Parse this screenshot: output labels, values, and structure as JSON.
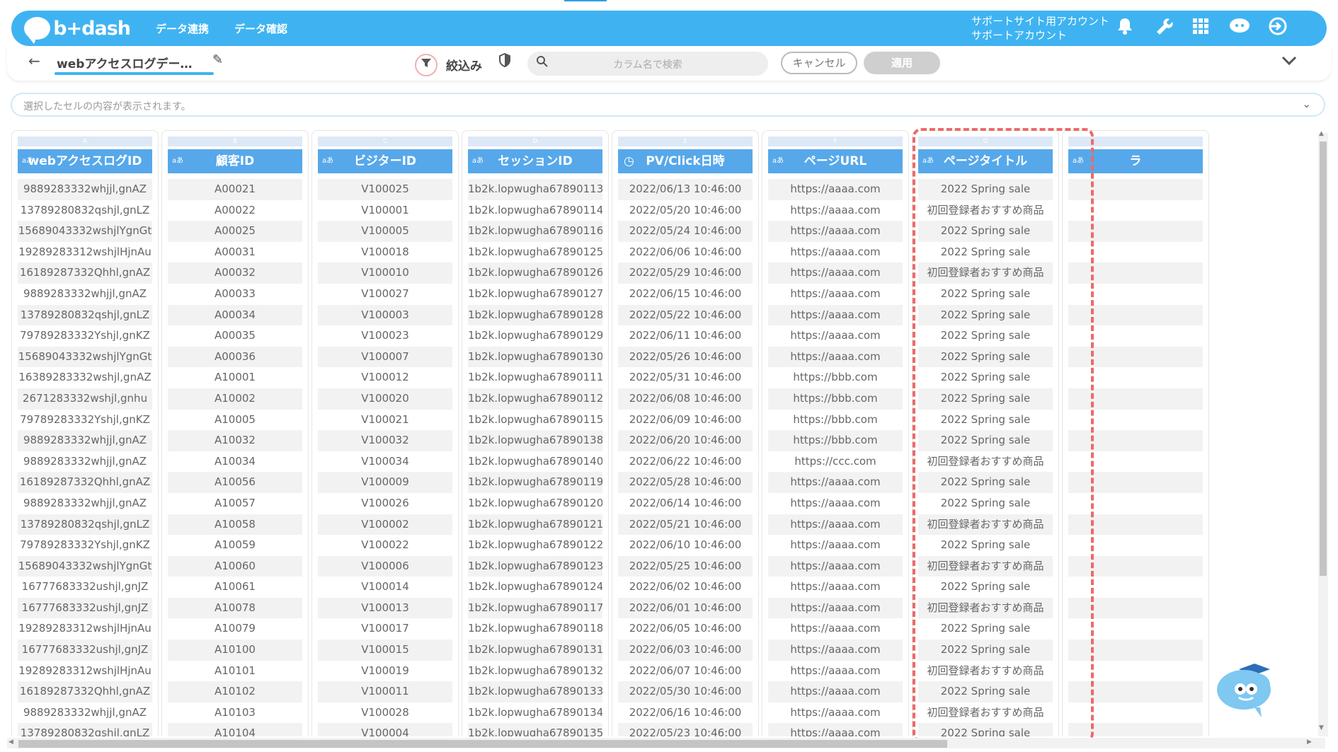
{
  "header": {
    "logo": "b+dash",
    "menu": [
      "データ連携",
      "データ確認"
    ],
    "account_line1": "サポートサイト用アカウント",
    "account_line2": "サポートアカウント"
  },
  "toolbar": {
    "table_name": "webアクセスログデー…",
    "filter_label": "絞込み",
    "search_placeholder": "カラム名で検索",
    "cancel_label": "キャンセル",
    "apply_label": "適用"
  },
  "cell_preview": {
    "placeholder": "選択したセルの内容が表示されます。"
  },
  "columns": [
    {
      "letter": "A",
      "type": "text",
      "type_label": "aあ",
      "name": "webアクセスログID",
      "cells": [
        "9889283332whjjl,gnAZ",
        "13789280832qshjl,gnLZ",
        "15689043332wshjlYgnGt",
        "19289283312wshjlHjnAu",
        "16189287332Qhhl,gnAZ",
        "9889283332whjjl,gnAZ",
        "13789280832qshjl,gnLZ",
        "79789283332Yshjl,gnKZ",
        "15689043332wshjlYgnGt",
        "16389283332wshjl,gnAZ",
        "2671283332wshjl,gnhu",
        "79789283332Yshjl,gnKZ",
        "9889283332whjjl,gnAZ",
        "9889283332whjjl,gnAZ",
        "16189287332Qhhl,gnAZ",
        "9889283332whjjl,gnAZ",
        "13789280832qshjl,gnLZ",
        "79789283332Yshjl,gnKZ",
        "15689043332wshjlYgnGt",
        "16777683332ushjl,gnJZ",
        "16777683332ushjl,gnJZ",
        "19289283312wshjlHjnAu",
        "16777683332ushjl,gnJZ",
        "19289283312wshjlHjnAu",
        "16189287332Qhhl,gnAZ",
        "9889283332whjjl,gnAZ",
        "13789280832qshjl,gnLZ"
      ]
    },
    {
      "letter": "B",
      "type": "text",
      "type_label": "aあ",
      "name": "顧客ID",
      "cells": [
        "A00021",
        "A00022",
        "A00025",
        "A00031",
        "A00032",
        "A00033",
        "A00034",
        "A00035",
        "A00036",
        "A10001",
        "A10002",
        "A10005",
        "A10032",
        "A10034",
        "A10056",
        "A10057",
        "A10058",
        "A10059",
        "A10060",
        "A10061",
        "A10078",
        "A10079",
        "A10100",
        "A10101",
        "A10102",
        "A10103",
        "A10104"
      ]
    },
    {
      "letter": "C",
      "type": "text",
      "type_label": "aあ",
      "name": "ビジターID",
      "cells": [
        "V100025",
        "V100001",
        "V100005",
        "V100018",
        "V100010",
        "V100027",
        "V100003",
        "V100023",
        "V100007",
        "V100012",
        "V100020",
        "V100021",
        "V100032",
        "V100034",
        "V100009",
        "V100026",
        "V100002",
        "V100022",
        "V100006",
        "V100014",
        "V100013",
        "V100017",
        "V100015",
        "V100019",
        "V100011",
        "V100028",
        "V100004"
      ]
    },
    {
      "letter": "D",
      "type": "text",
      "type_label": "aあ",
      "name": "セッションID",
      "cells": [
        "1b2k.lopwugha67890113",
        "1b2k.lopwugha67890114",
        "1b2k.lopwugha67890116",
        "1b2k.lopwugha67890125",
        "1b2k.lopwugha67890126",
        "1b2k.lopwugha67890127",
        "1b2k.lopwugha67890128",
        "1b2k.lopwugha67890129",
        "1b2k.lopwugha67890130",
        "1b2k.lopwugha67890111",
        "1b2k.lopwugha67890112",
        "1b2k.lopwugha67890115",
        "1b2k.lopwugha67890138",
        "1b2k.lopwugha67890140",
        "1b2k.lopwugha67890119",
        "1b2k.lopwugha67890120",
        "1b2k.lopwugha67890121",
        "1b2k.lopwugha67890122",
        "1b2k.lopwugha67890123",
        "1b2k.lopwugha67890124",
        "1b2k.lopwugha67890117",
        "1b2k.lopwugha67890118",
        "1b2k.lopwugha67890131",
        "1b2k.lopwugha67890132",
        "1b2k.lopwugha67890133",
        "1b2k.lopwugha67890134",
        "1b2k.lopwugha67890135"
      ]
    },
    {
      "letter": "E",
      "type": "datetime",
      "type_label": "◷",
      "name": "PV/Click日時",
      "cells": [
        "2022/06/13 10:46:00",
        "2022/05/20 10:46:00",
        "2022/05/24 10:46:00",
        "2022/06/06 10:46:00",
        "2022/05/29 10:46:00",
        "2022/06/15 10:46:00",
        "2022/05/22 10:46:00",
        "2022/06/11 10:46:00",
        "2022/05/26 10:46:00",
        "2022/05/31 10:46:00",
        "2022/06/08 10:46:00",
        "2022/06/09 10:46:00",
        "2022/06/20 10:46:00",
        "2022/06/22 10:46:00",
        "2022/05/28 10:46:00",
        "2022/06/14 10:46:00",
        "2022/05/21 10:46:00",
        "2022/06/10 10:46:00",
        "2022/05/25 10:46:00",
        "2022/06/02 10:46:00",
        "2022/06/01 10:46:00",
        "2022/06/05 10:46:00",
        "2022/06/03 10:46:00",
        "2022/06/07 10:46:00",
        "2022/05/30 10:46:00",
        "2022/06/16 10:46:00",
        "2022/05/23 10:46:00"
      ]
    },
    {
      "letter": "F",
      "type": "text",
      "type_label": "aあ",
      "name": "ページURL",
      "cells": [
        "https://aaaa.com",
        "https://aaaa.com",
        "https://aaaa.com",
        "https://aaaa.com",
        "https://aaaa.com",
        "https://aaaa.com",
        "https://aaaa.com",
        "https://aaaa.com",
        "https://aaaa.com",
        "https://bbb.com",
        "https://bbb.com",
        "https://bbb.com",
        "https://bbb.com",
        "https://ccc.com",
        "https://aaaa.com",
        "https://aaaa.com",
        "https://aaaa.com",
        "https://aaaa.com",
        "https://aaaa.com",
        "https://aaaa.com",
        "https://aaaa.com",
        "https://aaaa.com",
        "https://aaaa.com",
        "https://aaaa.com",
        "https://aaaa.com",
        "https://aaaa.com",
        "https://aaaa.com"
      ]
    },
    {
      "letter": "G",
      "type": "text",
      "type_label": "aあ",
      "name": "ページタイトル",
      "cells": [
        "2022 Spring sale",
        "初回登録者おすすめ商品",
        "2022 Spring sale",
        "2022 Spring sale",
        "初回登録者おすすめ商品",
        "2022 Spring sale",
        "2022 Spring sale",
        "2022 Spring sale",
        "2022 Spring sale",
        "2022 Spring sale",
        "2022 Spring sale",
        "2022 Spring sale",
        "2022 Spring sale",
        "初回登録者おすすめ商品",
        "2022 Spring sale",
        "2022 Spring sale",
        "初回登録者おすすめ商品",
        "2022 Spring sale",
        "初回登録者おすすめ商品",
        "2022 Spring sale",
        "初回登録者おすすめ商品",
        "2022 Spring sale",
        "2022 Spring sale",
        "初回登録者おすすめ商品",
        "2022 Spring sale",
        "初回登録者おすすめ商品",
        "2022 Spring sale"
      ]
    },
    {
      "letter": "",
      "type": "text",
      "type_label": "aあ",
      "name": "ラ",
      "cells": [
        "",
        "",
        "",
        "",
        "",
        "",
        "",
        "",
        "",
        "",
        "",
        "",
        "",
        "",
        "",
        "",
        "",
        "",
        "",
        "",
        "",
        "",
        "",
        "",
        "",
        "",
        ""
      ]
    }
  ],
  "colors": {
    "header_bg": "#3fb3f2",
    "column_header_bg": "#56a8ea",
    "highlight_border": "#ec6a6a"
  },
  "icons": [
    "bell-icon",
    "wrench-icon",
    "apps-grid-icon",
    "chat-cloud-icon",
    "logout-icon",
    "back-arrow-icon",
    "pencil-icon",
    "filter-icon",
    "shield-icon",
    "search-icon",
    "chevron-down-icon"
  ]
}
